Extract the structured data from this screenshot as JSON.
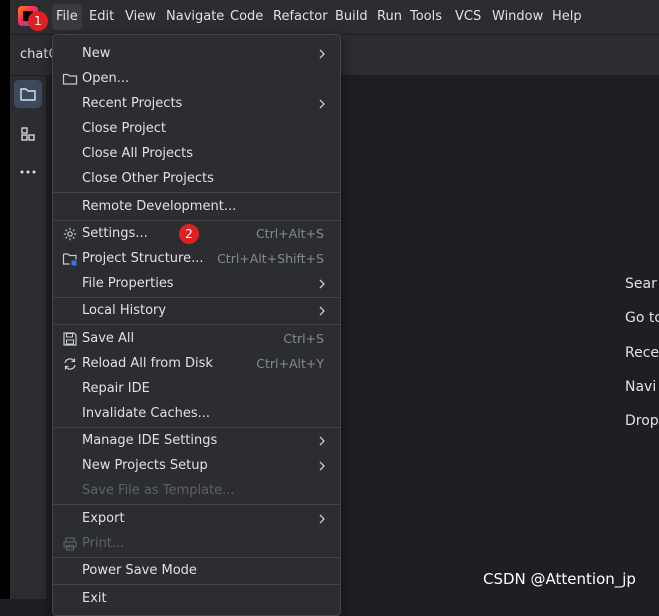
{
  "menubar": {
    "items": [
      {
        "label": "File"
      },
      {
        "label": "Edit"
      },
      {
        "label": "View"
      },
      {
        "label": "Navigate"
      },
      {
        "label": "Code"
      },
      {
        "label": "Refactor"
      },
      {
        "label": "Build"
      },
      {
        "label": "Run"
      },
      {
        "label": "Tools"
      },
      {
        "label": "VCS"
      },
      {
        "label": "Window"
      },
      {
        "label": "Help"
      }
    ]
  },
  "badges": {
    "one": "1",
    "two": "2"
  },
  "tab": {
    "title": "chatC"
  },
  "file_menu": {
    "new": "New",
    "open": "Open...",
    "recent_projects": "Recent Projects",
    "close_project": "Close Project",
    "close_all_projects": "Close All Projects",
    "close_other_projects": "Close Other Projects",
    "remote_development": "Remote Development...",
    "settings": "Settings...",
    "settings_shortcut": "Ctrl+Alt+S",
    "project_structure": "Project Structure...",
    "project_structure_shortcut": "Ctrl+Alt+Shift+S",
    "file_properties": "File Properties",
    "local_history": "Local History",
    "save_all": "Save All",
    "save_all_shortcut": "Ctrl+S",
    "reload_all": "Reload All from Disk",
    "reload_all_shortcut": "Ctrl+Alt+Y",
    "repair_ide": "Repair IDE",
    "invalidate_caches": "Invalidate Caches...",
    "manage_ide_settings": "Manage IDE Settings",
    "new_projects_setup": "New Projects Setup",
    "save_file_as_template": "Save File as Template...",
    "export": "Export",
    "print": "Print...",
    "power_save_mode": "Power Save Mode",
    "exit": "Exit"
  },
  "welcome": {
    "line1": "Sear",
    "line2": "Go to",
    "line3": "Rece",
    "line4": "Navi",
    "line5": "Drop"
  },
  "watermark": "CSDN @Attention_jp",
  "colors": {
    "background": "#1e1f22",
    "panel": "#2b2d30",
    "badge": "#e02020",
    "text": "#dfe1e5",
    "shortcut": "#868a91",
    "disabled": "#5e6168"
  }
}
